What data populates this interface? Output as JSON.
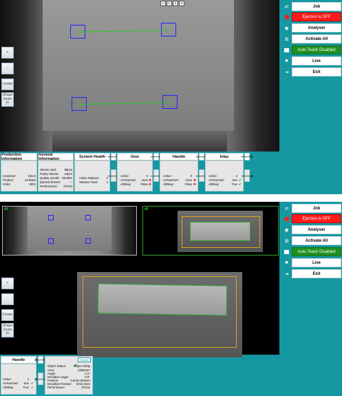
{
  "menu": {
    "items": [
      {
        "label": "Job",
        "icon": "⇄",
        "style": "normal"
      },
      {
        "label": "Ejection is OFF",
        "icon": "■",
        "style": "red"
      },
      {
        "label": "Analyser",
        "icon": "◉",
        "style": "normal"
      },
      {
        "label": "Activate All",
        "icon": "⊞",
        "style": "normal"
      },
      {
        "label": "Auto Teach Disabled",
        "icon": "▣",
        "style": "green"
      },
      {
        "label": "Live",
        "icon": "■",
        "style": "normal"
      },
      {
        "label": "Exit",
        "icon": "⇥",
        "style": "normal"
      }
    ]
  },
  "side_buttons": {
    "plus": "+",
    "minus": "-",
    "center": "Center",
    "shape_zoom": "Shape Zoom in"
  },
  "screen1": {
    "panels": {
      "production": {
        "title": "Production Information",
        "rows": [
          {
            "k": "Customer:",
            "v": "Vision"
          },
          {
            "k": "Product:",
            "v": "scribaim"
          },
          {
            "k": "Order:",
            "v": "0001"
          }
        ]
      },
      "general": {
        "title": "General Information",
        "rows": [
          {
            "k": "Sheets total:",
            "v": "99pcs"
          },
          {
            "k": "Faulty Sheets:",
            "v": "13pcs"
          },
          {
            "k": "Quality overall:",
            "v": "86.86%"
          },
          {
            "k": "Ejected Sheets:",
            "v": "---"
          },
          {
            "k": "Performance:",
            "v": "37/min"
          }
        ]
      },
      "health": {
        "title": "System Health",
        "rows": [
          {
            "k": "Active Stations:",
            "v": "1"
          },
          {
            "k": "Stations Total:",
            "v": "1"
          }
        ]
      },
      "glue": {
        "title": "Glue",
        "rows": [
          {
            "k": "Active:",
            "v": "0",
            "s": ""
          },
          {
            "k": "AnTeached:",
            "v": "none",
            "s": "✖"
          },
          {
            "k": "AllOkay:",
            "v": "False",
            "s": "✖"
          }
        ]
      },
      "handle": {
        "title": "Handle",
        "rows": [
          {
            "k": "Active:",
            "v": "0",
            "s": ""
          },
          {
            "k": "AnTeached:",
            "v": "none",
            "s": "✖"
          },
          {
            "k": "AllOkay:",
            "v": "False",
            "s": "✖"
          }
        ]
      },
      "inlay": {
        "title": "Inlay",
        "rows": [
          {
            "k": "Active:",
            "v": "2",
            "s": ""
          },
          {
            "k": "AnTeached:",
            "v": "true",
            "s": "✔"
          },
          {
            "k": "AllOkay:",
            "v": "True",
            "s": "✔"
          }
        ]
      }
    },
    "arrow": "🡒",
    "toolbar": [
      "1",
      "2",
      "3",
      "4"
    ]
  },
  "screen2": {
    "thumb_left_label": "#1",
    "thumb_right_label": "#2",
    "handle_panel": {
      "title": "Handle",
      "rows": [
        {
          "k": "Active:",
          "v": "1",
          "s": ""
        },
        {
          "k": "AnTeached:",
          "v": "true",
          "s": "✔"
        },
        {
          "k": "AllOkay:",
          "v": "True",
          "s": "✔"
        }
      ]
    },
    "back_arrow": "🡐",
    "detail_panel": {
      "tag": "Handle",
      "rows": [
        {
          "k": "Object Status:",
          "v": "Object Okay",
          "s": "✔"
        },
        {
          "k": "Area:",
          "v": "1360mm²",
          "s": ""
        },
        {
          "k": "Angle:",
          "v": "1.0°",
          "s": ""
        },
        {
          "k": "Deviation Angle:",
          "v": "0.0°",
          "s": ""
        },
        {
          "k": "Position:",
          "v": "0.6mm,265mm",
          "s": ""
        },
        {
          "k": "Deviation Position:",
          "v": "0mm,0mm",
          "s": ""
        },
        {
          "k": "Performance:",
          "v": "37/min",
          "s": ""
        }
      ]
    }
  }
}
